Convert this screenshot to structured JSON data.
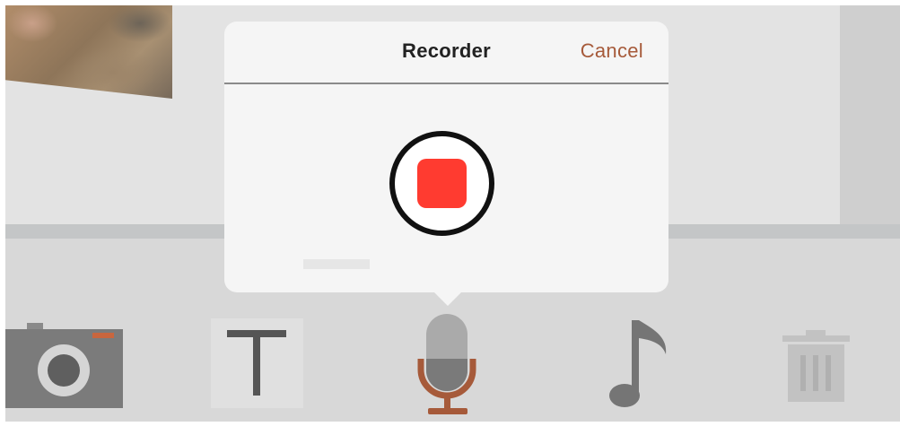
{
  "popover": {
    "title": "Recorder",
    "cancel_label": "Cancel"
  },
  "toolbar": {
    "tools": [
      {
        "name": "camera",
        "icon": "camera-icon"
      },
      {
        "name": "text",
        "icon": "text-icon",
        "glyph": "T"
      },
      {
        "name": "audio",
        "icon": "microphone-icon",
        "active": true
      },
      {
        "name": "music",
        "icon": "music-note-icon"
      },
      {
        "name": "delete",
        "icon": "trash-icon"
      }
    ]
  },
  "colors": {
    "accent": "#a65a3a",
    "record": "#ff3b30",
    "toolbar_bg": "#d8d8d8",
    "popover_bg": "#f5f5f5"
  }
}
